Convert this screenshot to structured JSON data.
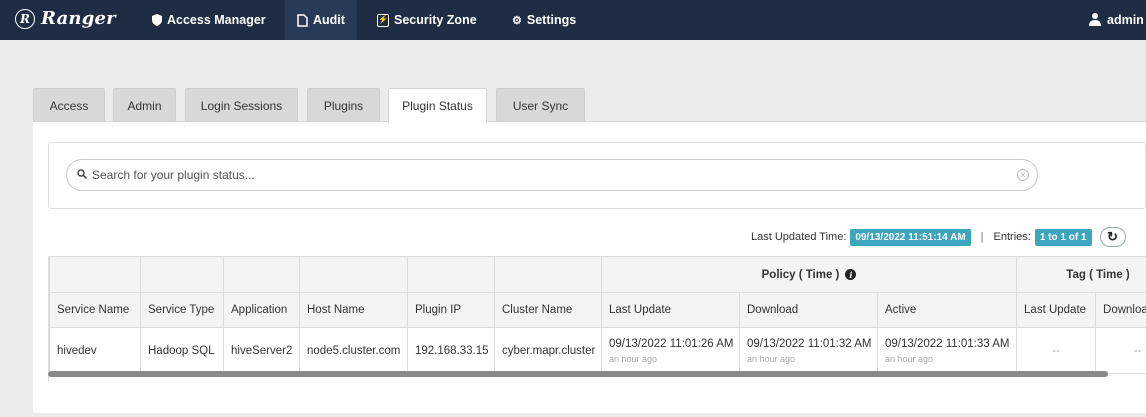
{
  "navbar": {
    "brand": "Ranger",
    "brand_logo": "R",
    "items": [
      {
        "label": "Access Manager",
        "icon": "shield-icon"
      },
      {
        "label": "Audit",
        "icon": "file-icon"
      },
      {
        "label": "Security Zone",
        "icon": "zone-icon"
      },
      {
        "label": "Settings",
        "icon": "gear-icon"
      }
    ],
    "user": "admin"
  },
  "tabs": [
    {
      "label": "Access"
    },
    {
      "label": "Admin"
    },
    {
      "label": "Login Sessions"
    },
    {
      "label": "Plugins"
    },
    {
      "label": "Plugin Status",
      "active": true
    },
    {
      "label": "User Sync"
    }
  ],
  "search": {
    "placeholder": "Search for your plugin status..."
  },
  "meta": {
    "last_updated_label": "Last Updated Time:",
    "last_updated_value": "09/13/2022 11:51:14 AM",
    "separator": "|",
    "entries_label": "Entries:",
    "entries_value": "1 to 1 of 1"
  },
  "table": {
    "group_headers": {
      "policy": "Policy ( Time )",
      "tag": "Tag ( Time )"
    },
    "columns": [
      "Service Name",
      "Service Type",
      "Application",
      "Host Name",
      "Plugin IP",
      "Cluster Name",
      "Last Update",
      "Download",
      "Active",
      "Last Update",
      "Download"
    ],
    "rows": [
      {
        "service_name": "hivedev",
        "service_type": "Hadoop SQL",
        "application": "hiveServer2",
        "host_name": "node5.cluster.com",
        "plugin_ip": "192.168.33.15",
        "cluster_name": "cyber.mapr.cluster",
        "policy_last_update": "09/13/2022 11:01:26 AM",
        "policy_last_update_rel": "an hour ago",
        "policy_download": "09/13/2022 11:01:32 AM",
        "policy_download_rel": "an hour ago",
        "policy_active": "09/13/2022 11:01:33 AM",
        "policy_active_rel": "an hour ago",
        "tag_last_update": "--",
        "tag_download": "--"
      }
    ]
  },
  "colors": {
    "navbar": "#1e2d44",
    "badge": "#3ba6bd"
  }
}
